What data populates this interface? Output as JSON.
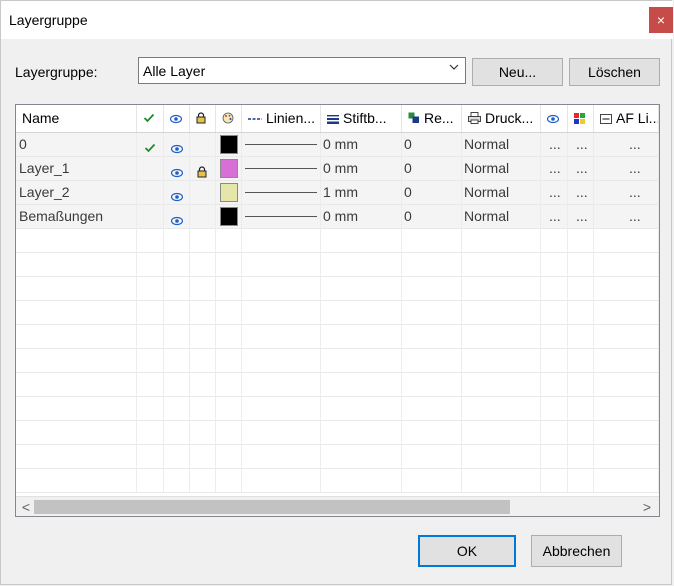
{
  "window": {
    "title": "Layergruppe",
    "close_label": "×"
  },
  "group": {
    "label": "Layergruppe:",
    "selected": "Alle Layer"
  },
  "buttons": {
    "new": "Neu...",
    "delete": "Löschen",
    "ok": "OK",
    "cancel": "Abbrechen"
  },
  "table": {
    "columns": [
      "Name",
      "",
      "",
      "",
      "",
      "Linien...",
      "Stiftb...",
      "Re...",
      "Druck...",
      "",
      "",
      "AF Li..."
    ],
    "column_icons": [
      "",
      "check-icon",
      "eye-icon",
      "lock-icon",
      "palette-icon",
      "linetype-icon",
      "penwidth-icon",
      "layer-order-icon",
      "printer-icon",
      "eye-icon",
      "color-grid-icon",
      "af-line-icon"
    ],
    "rows": [
      {
        "name": "0",
        "active": true,
        "visible": true,
        "locked": false,
        "color": "#000000",
        "pen": "0 mm",
        "re": "0",
        "druck": "Normal",
        "c9": "...",
        "c10": "...",
        "c11": "..."
      },
      {
        "name": "Layer_1",
        "active": false,
        "visible": true,
        "locked": true,
        "color": "#d86fd6",
        "pen": "0 mm",
        "re": "0",
        "druck": "Normal",
        "c9": "...",
        "c10": "...",
        "c11": "..."
      },
      {
        "name": "Layer_2",
        "active": false,
        "visible": true,
        "locked": false,
        "color": "#e6e6a8",
        "pen": "1 mm",
        "re": "0",
        "druck": "Normal",
        "c9": "...",
        "c10": "...",
        "c11": "..."
      },
      {
        "name": "Bemaßungen",
        "active": false,
        "visible": true,
        "locked": false,
        "color": "#000000",
        "pen": "0 mm",
        "re": "0",
        "druck": "Normal",
        "c9": "...",
        "c10": "...",
        "c11": "..."
      }
    ],
    "scroll_left": "<",
    "scroll_right": ">"
  },
  "colors": {
    "close_bg": "#c74b49",
    "check": "#1f8a2a",
    "eye": "#1f5ec9"
  }
}
